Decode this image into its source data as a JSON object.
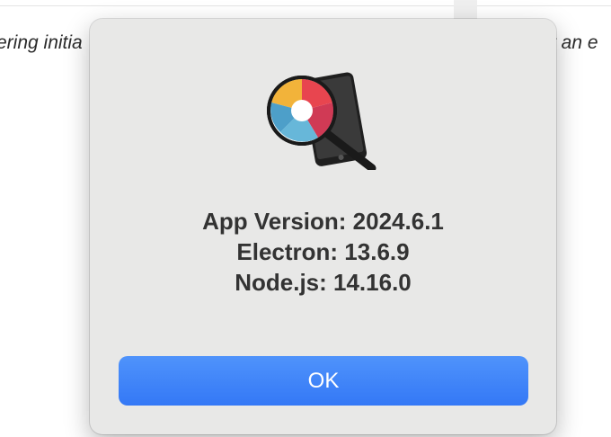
{
  "background": {
    "left_text": "ering initia",
    "right_text": "t an e"
  },
  "dialog": {
    "icon": "magnifier-phone-app-icon",
    "version_line": "App Version: 2024.6.1",
    "electron_line": "Electron: 13.6.9",
    "node_line": "Node.js: 14.16.0",
    "ok_label": "OK"
  },
  "colors": {
    "dialog_bg": "#e8e8e7",
    "accent": "#3478f6",
    "text": "#333333"
  }
}
